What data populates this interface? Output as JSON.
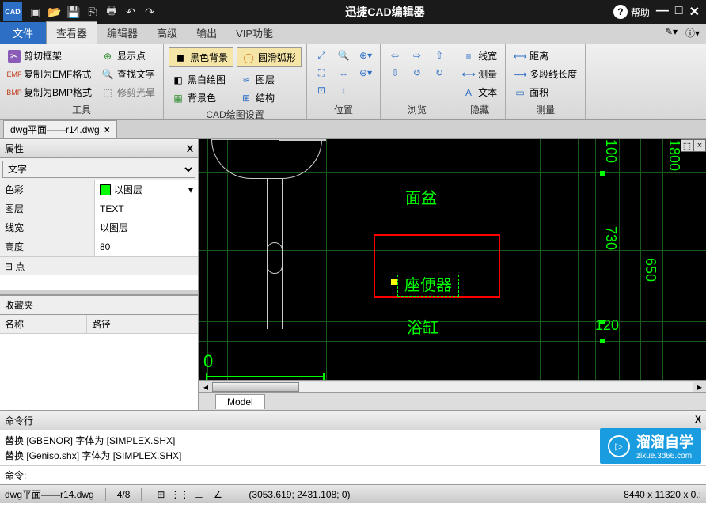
{
  "app": {
    "title": "迅捷CAD编辑器",
    "logo": "CAD"
  },
  "help": {
    "label": "帮助"
  },
  "file_tab": "文件",
  "tabs": [
    "查看器",
    "编辑器",
    "高级",
    "输出",
    "VIP功能"
  ],
  "active_tab_index": 0,
  "ribbon": {
    "tools": {
      "label": "工具",
      "crop": "剪切框架",
      "copy_emf": "复制为EMF格式",
      "copy_bmp": "复制为BMP格式",
      "show_pts": "显示点",
      "find_text": "查找文字",
      "trim_halo": "修剪光晕"
    },
    "draw": {
      "label": "CAD绘图设置",
      "black_bg": "黑色背景",
      "smooth_arc": "圆滑弧形",
      "bw_draw": "黑白绘图",
      "layers": "图层",
      "bg_color": "背景色",
      "structure": "结构"
    },
    "position": {
      "label": "位置"
    },
    "browse": {
      "label": "浏览"
    },
    "hide": {
      "label": "隐藏",
      "linew": "线宽",
      "measure": "测量",
      "text": "文本"
    },
    "measure": {
      "label": "测量",
      "distance": "距离",
      "multiseg": "多段线长度",
      "area": "面积"
    }
  },
  "doc_tab": "dwg平面——r14.dwg",
  "properties": {
    "header": "属性",
    "select_value": "文字",
    "rows": {
      "color": {
        "k": "色彩",
        "v": "以图层"
      },
      "layer": {
        "k": "图层",
        "v": "TEXT"
      },
      "linew": {
        "k": "线宽",
        "v": "以图层"
      },
      "height": {
        "k": "高度",
        "v": "80"
      }
    },
    "expand": "点"
  },
  "favorites": {
    "header": "收藏夹",
    "col_name": "名称",
    "col_path": "路径"
  },
  "canvas": {
    "labels": {
      "basin": "面盆",
      "toilet": "座便器",
      "bathtub": "浴缸"
    },
    "dims": {
      "d100": "100",
      "d1800": "1800",
      "d730": "730",
      "d650": "650",
      "d120": "120"
    },
    "zero": "0"
  },
  "model_tab": "Model",
  "cmd": {
    "header": "命令行",
    "line1": "替换 [GBENOR] 字体为 [SIMPLEX.SHX]",
    "line2": "替换 [Geniso.shx] 字体为 [SIMPLEX.SHX]",
    "prompt": "命令: "
  },
  "status": {
    "file": "dwg平面——r14.dwg",
    "page": "4/8",
    "coords": "(3053.619; 2431.108; 0)",
    "size": "8440 x 11320 x 0.:"
  },
  "watermark": {
    "text": "溜溜自学",
    "url": "zixue.3d66.com"
  }
}
